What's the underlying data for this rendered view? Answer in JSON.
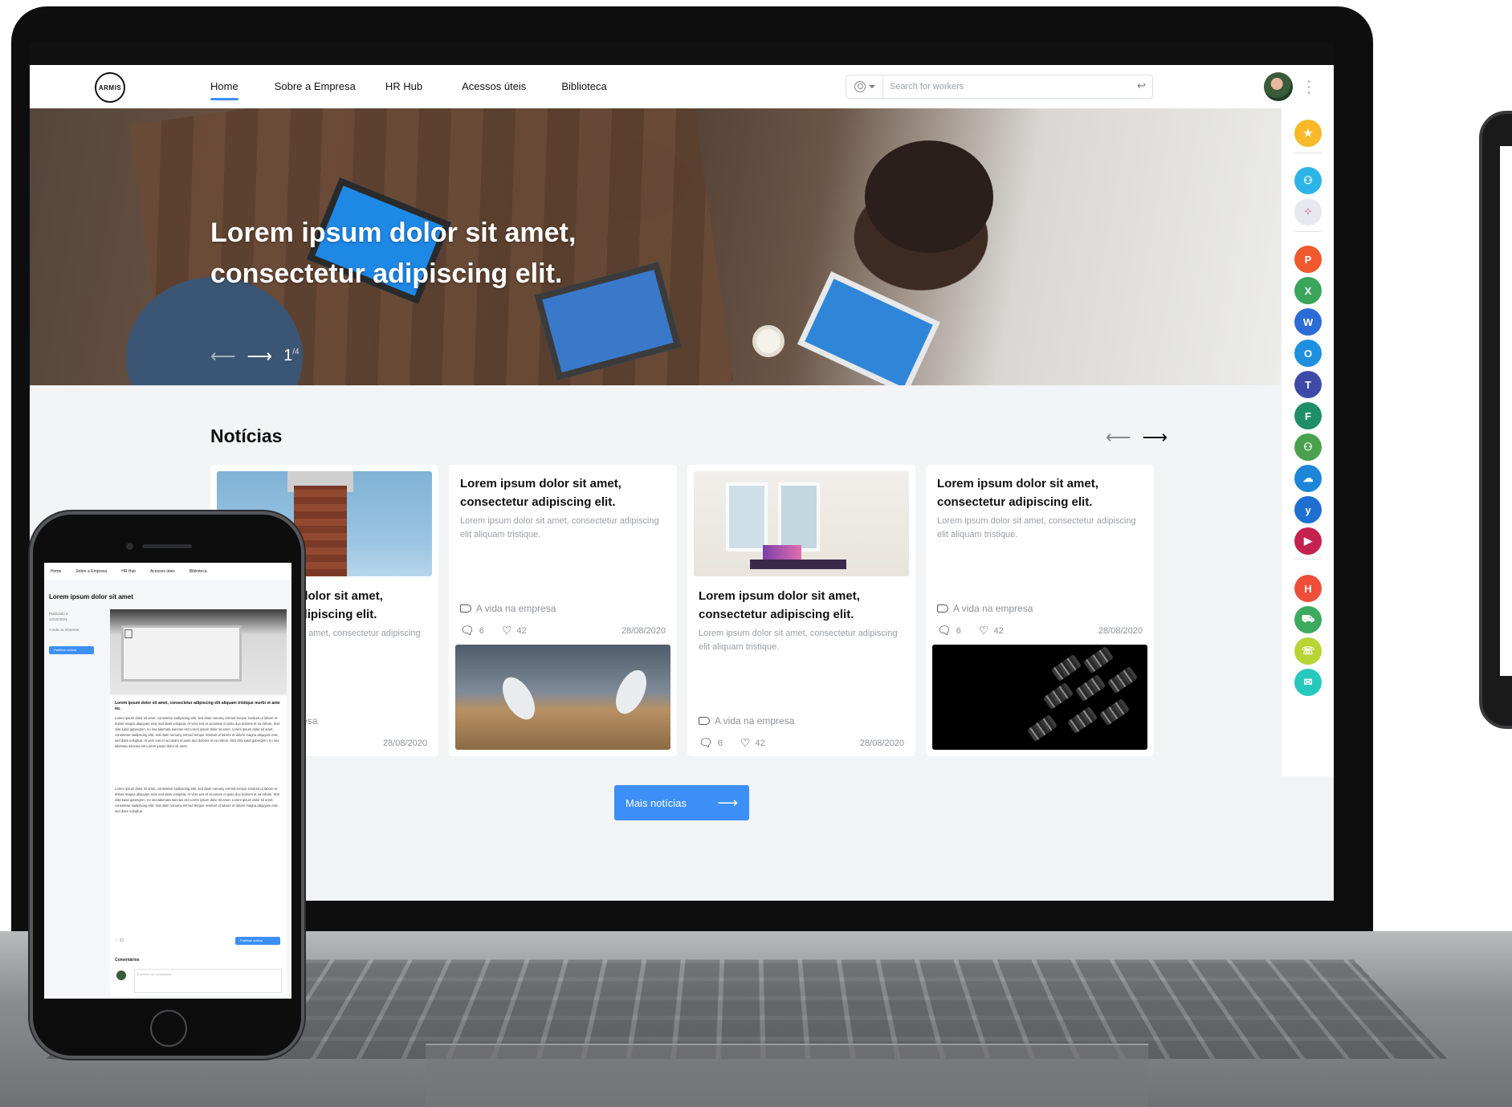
{
  "nav": {
    "logo_text": "ARMIS",
    "items": [
      {
        "label": "Home",
        "active": true
      },
      {
        "label": "Sobre a Empresa",
        "active": false
      },
      {
        "label": "HR Hub",
        "active": false
      },
      {
        "label": "Acessos úteis",
        "active": false
      },
      {
        "label": "Biblioteca",
        "active": false
      }
    ]
  },
  "search": {
    "placeholder": "Search for workers",
    "enter_icon": "↩"
  },
  "hero": {
    "title": "Lorem ipsum dolor sit amet, consectetur adipiscing elit.",
    "current_slide": "1",
    "total_slides": "/4"
  },
  "apps": [
    {
      "icon": "star-icon",
      "color": "#f7b928",
      "glyph": "★"
    },
    {
      "icon": "people-icon",
      "color": "#2db5e6",
      "glyph": "⚇"
    },
    {
      "icon": "dots-icon",
      "color": "#e6e9ef",
      "glyph": "⁘"
    },
    {
      "icon": "powerpoint-icon",
      "color": "#f0582d",
      "glyph": "P"
    },
    {
      "icon": "excel-icon",
      "color": "#3aa55b",
      "glyph": "X"
    },
    {
      "icon": "word-icon",
      "color": "#2b6cd6",
      "glyph": "W"
    },
    {
      "icon": "outlook-icon",
      "color": "#1f8fe0",
      "glyph": "O"
    },
    {
      "icon": "teams-icon",
      "color": "#3d4aa8",
      "glyph": "T"
    },
    {
      "icon": "forms-icon",
      "color": "#1f8f6a",
      "glyph": "F"
    },
    {
      "icon": "groups-icon",
      "color": "#4aa04c",
      "glyph": "⚇"
    },
    {
      "icon": "onedrive-icon",
      "color": "#1e86d8",
      "glyph": "☁"
    },
    {
      "icon": "yammer-icon",
      "color": "#1f6fd0",
      "glyph": "y"
    },
    {
      "icon": "stream-icon",
      "color": "#c5224f",
      "glyph": "▶"
    },
    {
      "icon": "hub-icon",
      "color": "#ef4f3a",
      "glyph": "H"
    },
    {
      "icon": "car-icon",
      "color": "#3daa5e",
      "glyph": "⛟"
    },
    {
      "icon": "support-icon",
      "color": "#b7d534",
      "glyph": "☏"
    },
    {
      "icon": "chat-icon",
      "color": "#27c9bd",
      "glyph": "✉"
    }
  ],
  "news": {
    "title": "Notícias",
    "more_button": "Mais notícias",
    "cards": [
      {
        "headline": "Lorem ipsum dolor sit amet, consectetur adipiscing elit.",
        "excerpt": "Lorem ipsum dolor sit amet, consectetur adipiscing elit aliquam tristique.",
        "tag": "A vida na empresa",
        "comments": "6",
        "likes": "42",
        "date": "28/08/2020",
        "image": "tower-photo"
      },
      {
        "headline": "Lorem ipsum dolor sit amet, consectetur adipiscing elit.",
        "excerpt": "Lorem ipsum dolor sit amet, consectetur adipiscing elit aliquam tristique.",
        "tag": "A vida na empresa",
        "comments": "6",
        "likes": "42",
        "date": "28/08/2020",
        "image": "satellite-dish-photo"
      },
      {
        "headline": "Lorem ipsum dolor sit amet, consectetur adipiscing elit.",
        "excerpt": "Lorem ipsum dolor sit amet, consectetur adipiscing elit aliquam tristique.",
        "tag": "A vida na empresa",
        "comments": "6",
        "likes": "42",
        "date": "28/08/2020",
        "image": "room-photo"
      },
      {
        "headline": "Lorem ipsum dolor sit amet, consectetur adipiscing elit.",
        "excerpt": "Lorem ipsum dolor sit amet, consectetur adipiscing elit aliquam tristique.",
        "tag": "A vida na empresa",
        "comments": "6",
        "likes": "42",
        "date": "28/08/2020",
        "image": "lenses-photo"
      }
    ]
  },
  "phone": {
    "nav": [
      "Home",
      "Sobre a Empresa",
      "HR Hub",
      "Acessos úteis",
      "Biblioteca"
    ],
    "title": "Lorem ipsum dolor sit amet",
    "published_label": "Publicado a",
    "published_date": "12/10/2021",
    "tag": "A vida na empresa",
    "share_button": "Partilhar notícia",
    "lead": "Lorem ipsum dolor sit amet, consectetur adipiscing elit aliquam tristique morbi et ante eu.",
    "body_1": "Lorem ipsum dolor sit amet, consetetur sadipscing elitr, sed diam nonumy eirmod tempor invidunt ut labore et dolore magna aliquyam erat, sed diam voluptua. At vero eos et accusam et justo duo dolores et ea rebum. Stet clita kasd gubergren, no sea takimata sanctus est Lorem ipsum dolor sit amet. Lorem ipsum dolor sit amet, consetetur sadipscing elitr, sed diam nonumy eirmod tempor invidunt ut labore et dolore magna aliquyam erat, sed diam voluptua. At vero eos et accusam et justo duo dolores et ea rebum. Stet clita kasd gubergren, no sea takimata sanctus est Lorem ipsum dolor sit amet.",
    "body_2": "Lorem ipsum dolor sit amet, consetetur sadipscing elitr, sed diam nonumy eirmod tempor invidunt ut labore et dolore magna aliquyam erat, sed diam voluptua. At vero eos et accusam et justo duo dolores et ea rebum. Stet clita kasd gubergren, no sea takimata sanctus est Lorem ipsum dolor sit amet. Lorem ipsum dolor sit amet, consetetur sadipscing elitr, sed diam nonumy eirmod tempor invidunt ut labore et dolore magna aliquyam erat, sed diam voluptua.",
    "likes": "21",
    "comments_title": "Comentários",
    "comment_placeholder": "Escreva um comentário"
  }
}
